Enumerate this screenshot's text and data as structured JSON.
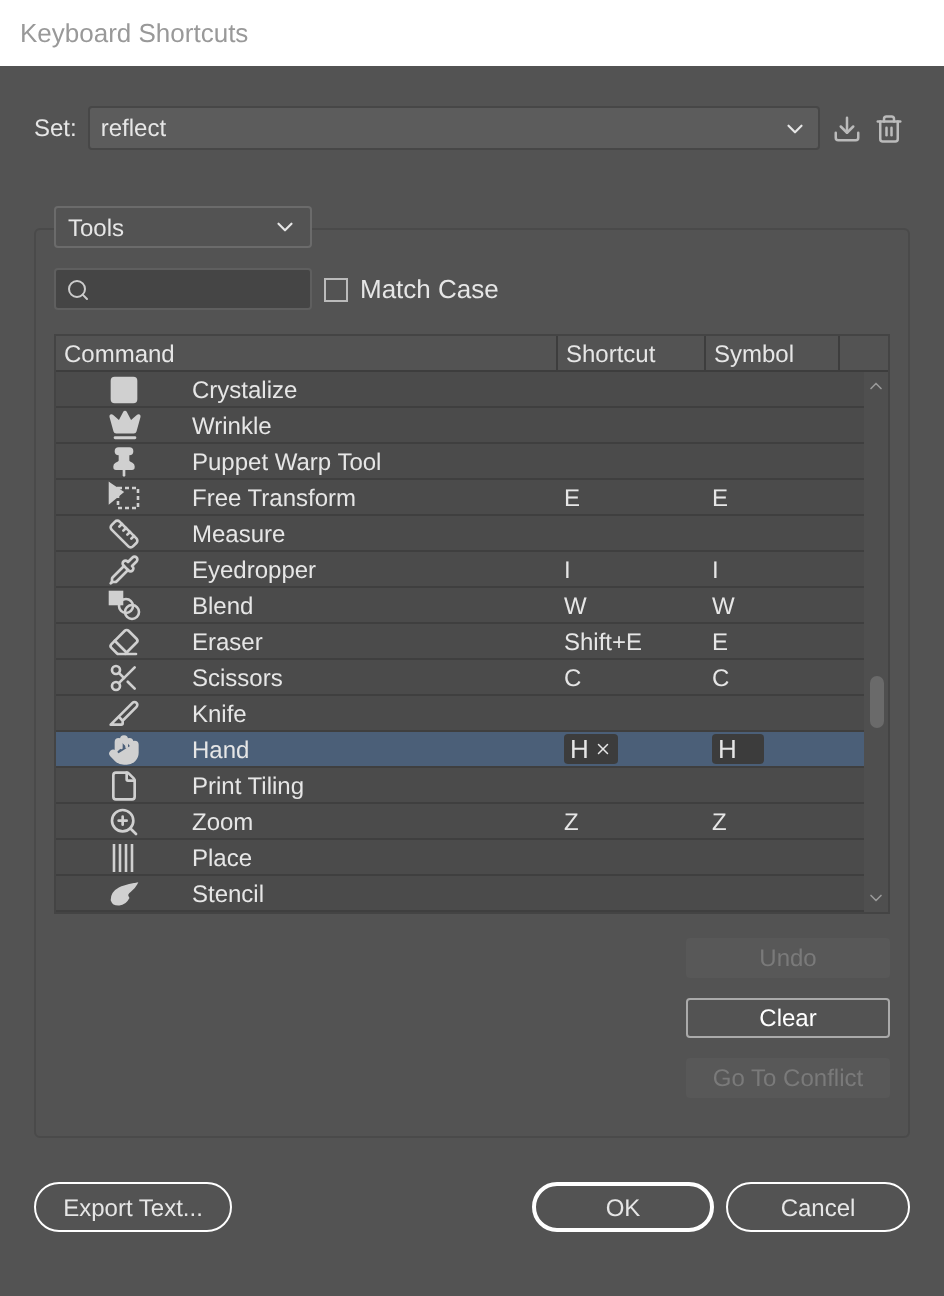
{
  "window": {
    "title": "Keyboard Shortcuts"
  },
  "set": {
    "label": "Set:",
    "value": "reflect"
  },
  "category": {
    "value": "Tools"
  },
  "match_case": {
    "label": "Match Case",
    "checked": false
  },
  "table": {
    "columns": [
      "Command",
      "Shortcut",
      "Symbol"
    ],
    "rows": [
      {
        "command": "Crystalize",
        "shortcut": "",
        "symbol": "",
        "selected": false
      },
      {
        "command": "Wrinkle",
        "shortcut": "",
        "symbol": "",
        "selected": false
      },
      {
        "command": "Puppet Warp Tool",
        "shortcut": "",
        "symbol": "",
        "selected": false
      },
      {
        "command": "Free Transform",
        "shortcut": "E",
        "symbol": "E",
        "selected": false
      },
      {
        "command": "Measure",
        "shortcut": "",
        "symbol": "",
        "selected": false
      },
      {
        "command": "Eyedropper",
        "shortcut": "I",
        "symbol": "I",
        "selected": false
      },
      {
        "command": "Blend",
        "shortcut": "W",
        "symbol": "W",
        "selected": false
      },
      {
        "command": "Eraser",
        "shortcut": "Shift+E",
        "symbol": "E",
        "selected": false
      },
      {
        "command": "Scissors",
        "shortcut": "C",
        "symbol": "C",
        "selected": false
      },
      {
        "command": "Knife",
        "shortcut": "",
        "symbol": "",
        "selected": false
      },
      {
        "command": "Hand",
        "shortcut": "H",
        "symbol": "H",
        "selected": true
      },
      {
        "command": "Print Tiling",
        "shortcut": "",
        "symbol": "",
        "selected": false
      },
      {
        "command": "Zoom",
        "shortcut": "Z",
        "symbol": "Z",
        "selected": false
      },
      {
        "command": "Place",
        "shortcut": "",
        "symbol": "",
        "selected": false
      },
      {
        "command": "Stencil",
        "shortcut": "",
        "symbol": "",
        "selected": false
      }
    ]
  },
  "side_buttons": [
    {
      "label": "Undo",
      "disabled": true
    },
    {
      "label": "Clear",
      "disabled": false
    },
    {
      "label": "Go To Conflict",
      "disabled": true
    }
  ],
  "footer": {
    "export": "Export Text...",
    "ok": "OK",
    "cancel": "Cancel"
  }
}
